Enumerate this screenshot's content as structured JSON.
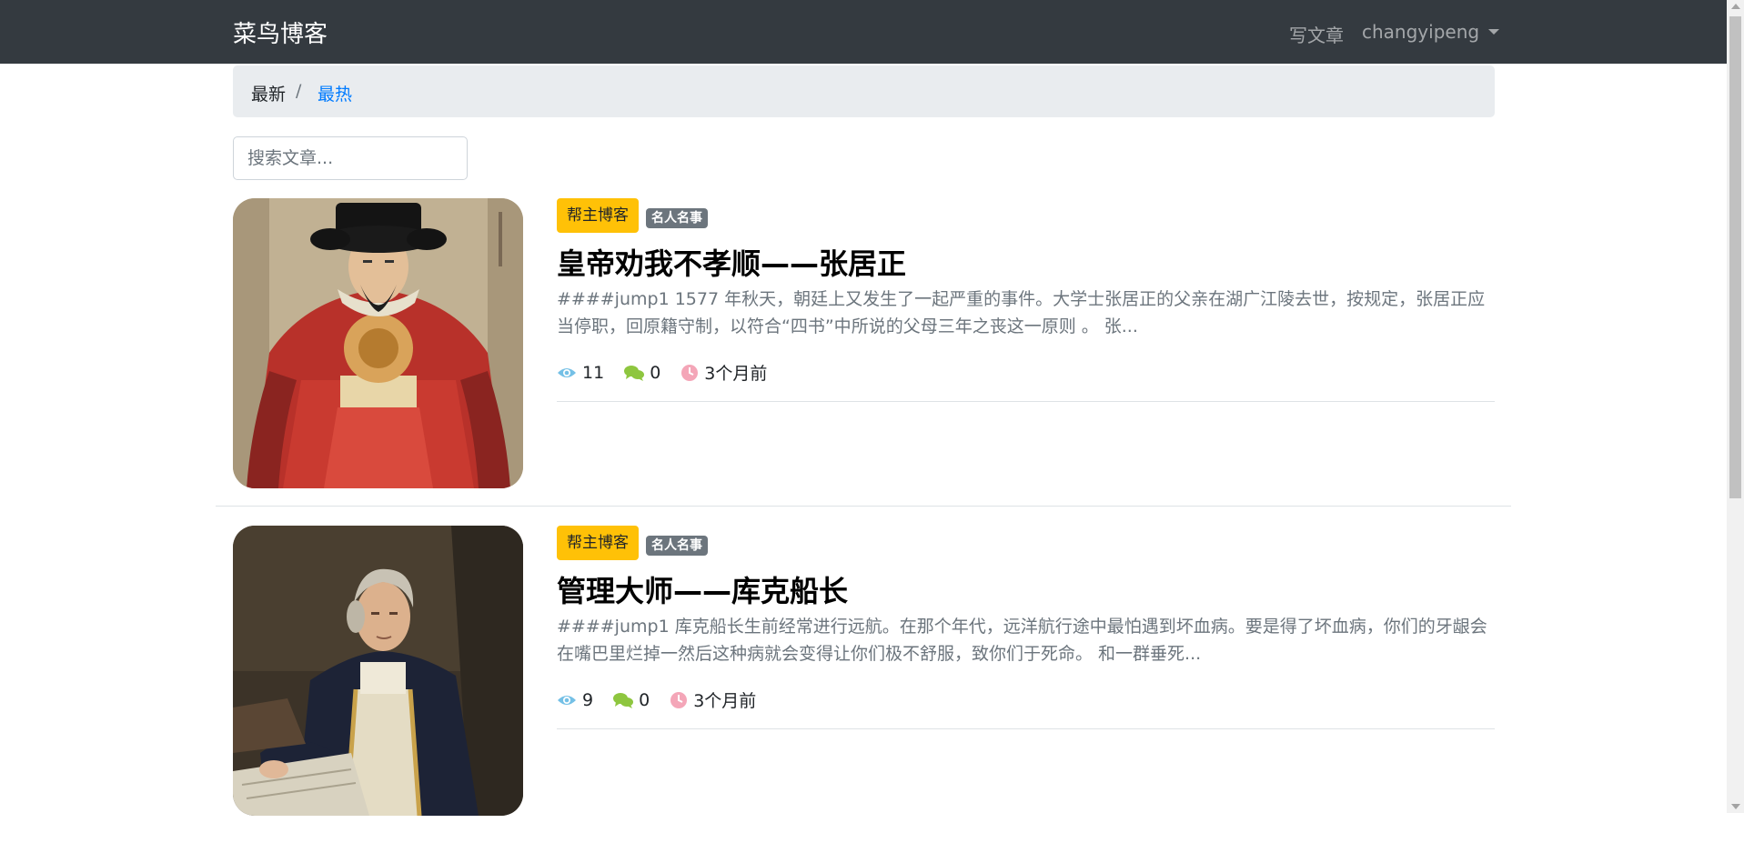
{
  "navbar": {
    "brand": "菜鸟博客",
    "write_label": "写文章",
    "user_label": "changyipeng"
  },
  "breadcrumb": {
    "newest": "最新",
    "separator": "/",
    "hottest": "最热"
  },
  "search": {
    "placeholder": "搜索文章..."
  },
  "articles": [
    {
      "category": "帮主博客",
      "tag": "名人名事",
      "title": "皇帝劝我不孝顺——张居正",
      "excerpt": "####jump1 1577 年秋天，朝廷上又发生了一起严重的事件。大学士张居正的父亲在湖广江陵去世，按规定，张居正应当停职，回原籍守制，以符合“四书”中所说的父母三年之丧这一原则 。 张...",
      "views": "11",
      "comments": "0",
      "time": "3个月前",
      "image": "portrait-ming-official"
    },
    {
      "category": "帮主博客",
      "tag": "名人名事",
      "title": "管理大师——库克船长",
      "excerpt": "####jump1 库克船长生前经常进行远航。在那个年代，远洋航行途中最怕遇到坏血病。要是得了坏血病，你们的牙龈会在嘴巴里烂掉一然后这种病就会变得让你们极不舒服，致你们于死命。 和一群垂死...",
      "views": "9",
      "comments": "0",
      "time": "3个月前",
      "image": "portrait-captain-cook"
    }
  ],
  "icons": {
    "views": "eye-icon",
    "comments": "comments-icon",
    "time": "clock-icon",
    "dropdown": "caret-down-icon"
  },
  "colors": {
    "navbar_bg": "#343a40",
    "category_badge": "#ffc107",
    "tag_badge": "#6c757d",
    "link_active": "#007bff",
    "eye_icon": "#74c0e6",
    "comment_icon": "#8ec63f",
    "clock_icon": "#f4a6b8"
  }
}
